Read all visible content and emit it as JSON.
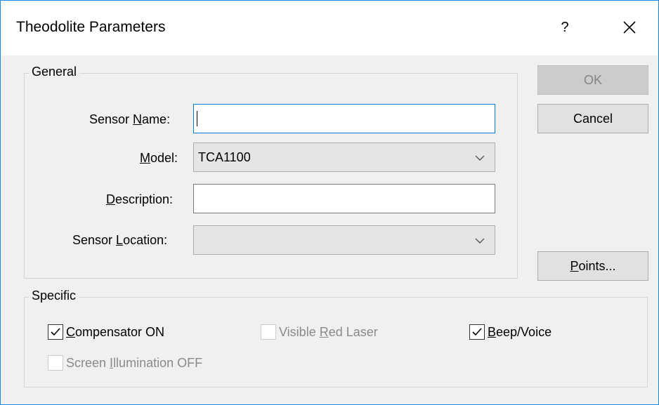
{
  "window": {
    "title": "Theodolite Parameters",
    "help_label": "?",
    "close_label": "×"
  },
  "general": {
    "legend": "General",
    "sensor_name": {
      "label_pre": "Sensor ",
      "label_accel": "N",
      "label_post": "ame:",
      "value": ""
    },
    "model": {
      "label_pre": "",
      "label_accel": "M",
      "label_post": "odel:",
      "value": "TCA1100"
    },
    "description": {
      "label_pre": "",
      "label_accel": "D",
      "label_post": "escription:",
      "value": ""
    },
    "sensor_location": {
      "label_pre": "Sensor ",
      "label_accel": "L",
      "label_post": "ocation:",
      "value": ""
    }
  },
  "buttons": {
    "ok": "OK",
    "cancel": "Cancel",
    "points_accel": "P",
    "points_post": "oints..."
  },
  "specific": {
    "legend": "Specific",
    "compensator": {
      "accel": "C",
      "post": "ompensator ON",
      "checked": true,
      "enabled": true
    },
    "red_laser": {
      "pre": "Visible ",
      "accel": "R",
      "post": "ed Laser",
      "checked": false,
      "enabled": false
    },
    "beep": {
      "accel": "B",
      "post": "eep/Voice",
      "checked": true,
      "enabled": true
    },
    "screen_illum": {
      "pre": "Screen ",
      "accel": "I",
      "post": "llumination OFF",
      "checked": false,
      "enabled": false
    }
  },
  "colors": {
    "focus_border": "#0078d7",
    "window_border": "#1e88e5",
    "disabled_text": "#838383"
  }
}
